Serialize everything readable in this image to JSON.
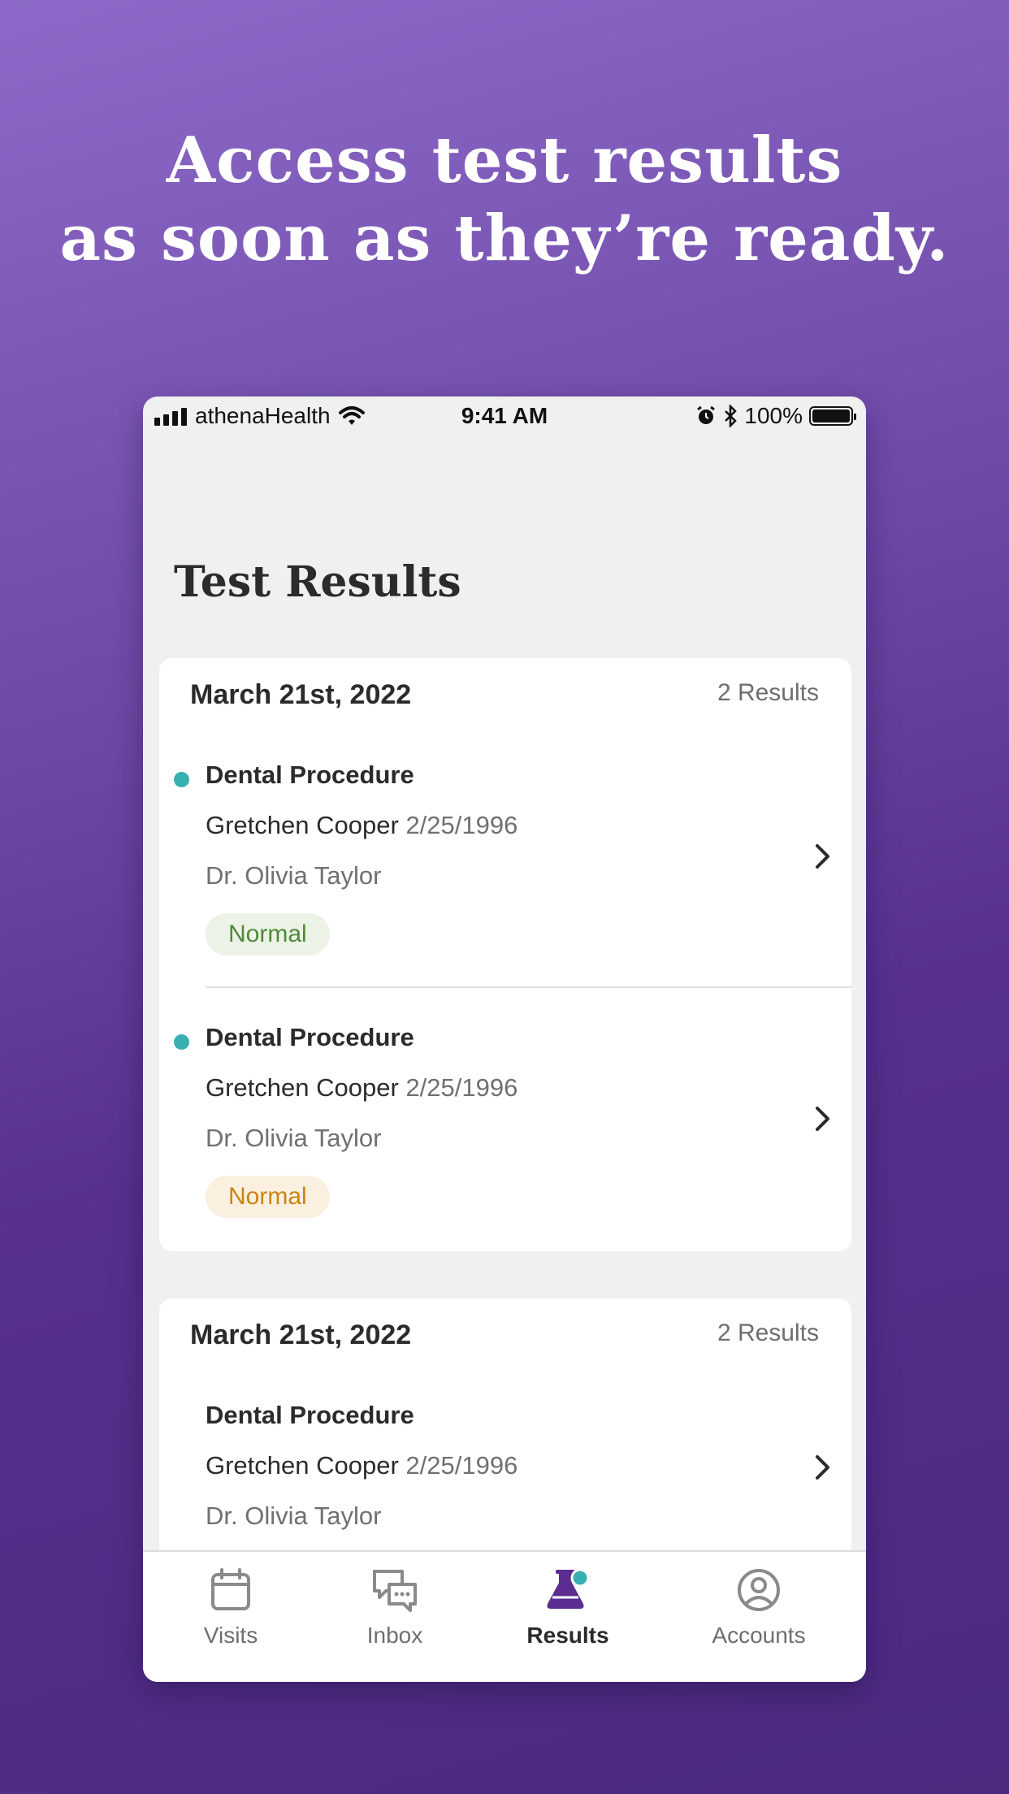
{
  "headline": {
    "line1": "Access test results",
    "line2": "as soon as they’re ready."
  },
  "statusbar": {
    "carrier": "athenaHealth",
    "time": "9:41 AM",
    "battery": "100%"
  },
  "page": {
    "title": "Test Results"
  },
  "groups": [
    {
      "date": "March 21st, 2022",
      "count": "2 Results",
      "items": [
        {
          "procedure": "Dental Procedure",
          "patient": "Gretchen Cooper",
          "dob": "2/25/1996",
          "doctor": "Dr. Olivia Taylor",
          "status": "Normal",
          "status_color": "#4d8a3a",
          "unread": true
        },
        {
          "procedure": "Dental Procedure",
          "patient": "Gretchen Cooper",
          "dob": "2/25/1996",
          "doctor": "Dr. Olivia Taylor",
          "status": "Normal",
          "status_color": "#c98513",
          "unread": true
        }
      ]
    },
    {
      "date": "March 21st, 2022",
      "count": "2 Results",
      "items": [
        {
          "procedure": "Dental Procedure",
          "patient": "Gretchen Cooper",
          "dob": "2/25/1996",
          "doctor": "Dr. Olivia Taylor",
          "unread": false
        }
      ]
    }
  ],
  "tabs": [
    {
      "label": "Visits",
      "icon": "calendar-icon"
    },
    {
      "label": "Inbox",
      "icon": "chat-icon"
    },
    {
      "label": "Results",
      "icon": "flask-icon",
      "active": true
    },
    {
      "label": "Accounts",
      "icon": "user-circle-icon"
    }
  ],
  "colors": {
    "accent": "#5b2d91",
    "unread_dot": "#38b0b1",
    "badge_teal": "#38b0b1"
  }
}
